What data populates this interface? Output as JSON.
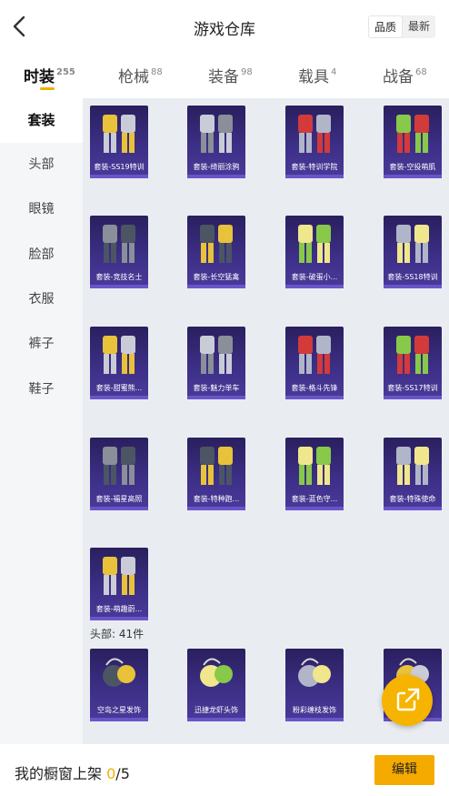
{
  "header": {
    "title": "游戏仓库",
    "sort_options": [
      "品质",
      "最新"
    ],
    "sort_selected": "品质"
  },
  "tabs": [
    {
      "label": "时装",
      "count": "255",
      "active": true
    },
    {
      "label": "枪械",
      "count": "88",
      "active": false
    },
    {
      "label": "装备",
      "count": "98",
      "active": false
    },
    {
      "label": "载具",
      "count": "4",
      "active": false
    },
    {
      "label": "战备",
      "count": "68",
      "active": false
    }
  ],
  "sidebar": {
    "items": [
      {
        "label": "套装",
        "active": true
      },
      {
        "label": "头部",
        "active": false
      },
      {
        "label": "眼镜",
        "active": false
      },
      {
        "label": "脸部",
        "active": false
      },
      {
        "label": "衣服",
        "active": false
      },
      {
        "label": "裤子",
        "active": false
      },
      {
        "label": "鞋子",
        "active": false
      }
    ]
  },
  "sets": [
    {
      "name": "套装-SS19特训"
    },
    {
      "name": "套装-绮丽涂鸦"
    },
    {
      "name": "套装-特训学院"
    },
    {
      "name": "套装-空投萌肌"
    },
    {
      "name": "套装-竞技名士"
    },
    {
      "name": "套装-长空猛禽"
    },
    {
      "name": "套装-破蛋小..."
    },
    {
      "name": "套装-SS18特训"
    },
    {
      "name": "套装-甜蜜熊..."
    },
    {
      "name": "套装-魅力单车"
    },
    {
      "name": "套装-格斗先锋"
    },
    {
      "name": "套装-SS17特训"
    },
    {
      "name": "套装-福星高照"
    },
    {
      "name": "套装-特种跑..."
    },
    {
      "name": "套装-蓝色守..."
    },
    {
      "name": "套装-特殊使命"
    },
    {
      "name": "套装-萌趣蔚..."
    }
  ],
  "head_section": {
    "label": "头部: 41件",
    "items": [
      {
        "name": "空岛之星发饰"
      },
      {
        "name": "迅捷龙虾头饰"
      },
      {
        "name": "粉彩缠枝发饰"
      },
      {
        "name": ""
      }
    ]
  },
  "bottom_bar": {
    "text": "我的橱窗上架",
    "count": "0",
    "total": "/5",
    "edit_label": "编辑"
  },
  "colors": {
    "accent": "#f5aa00",
    "item_bg": "#3c2f86",
    "item_bar": "#6b54c9"
  }
}
